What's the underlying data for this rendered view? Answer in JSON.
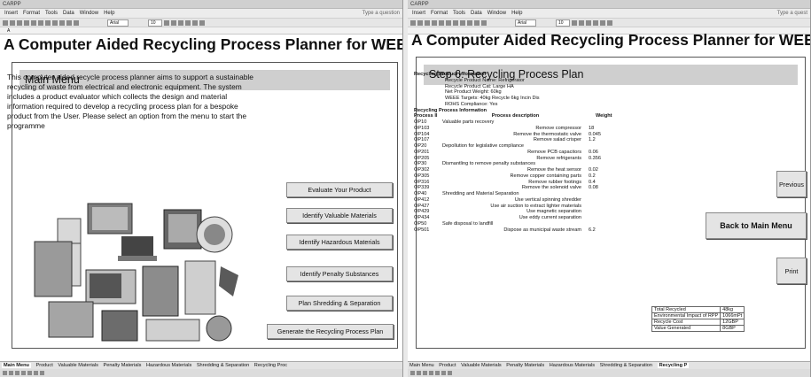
{
  "left": {
    "app_title": "CARPP",
    "menu": [
      "Insert",
      "Format",
      "Tools",
      "Data",
      "Window",
      "Help"
    ],
    "help_box": "Type a question",
    "font_name": "Arial",
    "font_size": "10",
    "name_box": "A",
    "page_title": "A Computer Aided Recycling Process Planner for WEEE",
    "panel_title": "Main Menu",
    "intro": "This computer aided recycle process planner aims to support a sustainable recycling of waste from electrical and electronic equipment. The system includes a product evaluator which collects the design and material information required to develop a recycling process plan for a bespoke product from the User. Please select an option from the menu to start the programme",
    "buttons": {
      "evaluate": "Evaluate Your Product",
      "valuable": "Identify Valuable Materials",
      "hazardous": "Identify Hazardous Materials",
      "penalty": "Identify Penalty Substances",
      "shredding": "Plan Shredding & Separation",
      "generate": "Generate the Recycling Process Plan"
    },
    "sheet_tabs": [
      "Main Menu",
      "Product",
      "Valuable Materials",
      "Penalty Materials",
      "Hazardous Materials",
      "Shredding & Separation",
      "Recycling Proc"
    ]
  },
  "right": {
    "app_title": "CARPP",
    "menu": [
      "Insert",
      "Format",
      "Tools",
      "Data",
      "Window",
      "Help"
    ],
    "help_box": "Type a quest",
    "font_name": "Arial",
    "font_size": "10",
    "page_title": "A Computer Aided Recycling Process Planner for WEEE",
    "panel_title": "Step 6: Recycling Process Plan",
    "product_info_heading": "Recycling Product Information",
    "product_info": [
      "Recycle Product Name: Refrigerator",
      "Recycle Product Cat: Large HA",
      "Net Product Weight: 60kg",
      "WEEE Targets: 40kg Recycle 6kg Incin Dis",
      "ROHS Compliance: Yes"
    ],
    "process_info_heading": "Recycling Process Information",
    "table_header": {
      "code": "Process II",
      "desc": "Process description",
      "weight": "Weight"
    },
    "rows": [
      {
        "code": "OP10",
        "desc": "Valuable parts recovery",
        "weight": "",
        "group": true
      },
      {
        "code": "OP103",
        "desc": "Remove compressor",
        "weight": "18",
        "group": false
      },
      {
        "code": "OP104",
        "desc": "Remove the thermostatic valve",
        "weight": "0.045",
        "group": false
      },
      {
        "code": "OP107",
        "desc": "Remove salad crisper",
        "weight": "1.2",
        "group": false
      },
      {
        "code": "OP20",
        "desc": "Depollution for legislative compliance",
        "weight": "",
        "group": true
      },
      {
        "code": "OP201",
        "desc": "Remove PCB capacitors",
        "weight": "0.06",
        "group": false
      },
      {
        "code": "OP205",
        "desc": "Remove refrigerants",
        "weight": "0.356",
        "group": false
      },
      {
        "code": "OP30",
        "desc": "Dismantling to remove penalty substances",
        "weight": "",
        "group": true
      },
      {
        "code": "OP302",
        "desc": "Remove the heat sensor",
        "weight": "0.02",
        "group": false
      },
      {
        "code": "OP305",
        "desc": "Remove copper containing parts",
        "weight": "0.2",
        "group": false
      },
      {
        "code": "OP316",
        "desc": "Remove rubber footings",
        "weight": "0.4",
        "group": false
      },
      {
        "code": "OP339",
        "desc": "Remove the solenoid valve",
        "weight": "0.08",
        "group": false
      },
      {
        "code": "OP40",
        "desc": "Shredding and Material Separation",
        "weight": "",
        "group": true
      },
      {
        "code": "OP412",
        "desc": "Use vertical spinning shredder",
        "weight": "",
        "group": false
      },
      {
        "code": "OP427",
        "desc": "Use air suction to extract lighter materials",
        "weight": "",
        "group": false
      },
      {
        "code": "OP429",
        "desc": "Use magnetic separation",
        "weight": "",
        "group": false
      },
      {
        "code": "OP434",
        "desc": "Use eddy current separation",
        "weight": "",
        "group": false
      },
      {
        "code": "OP50",
        "desc": "Safe disposal to landfill",
        "weight": "",
        "group": true
      },
      {
        "code": "OP501",
        "desc": "Dispose as municipal waste stream",
        "weight": "6.2",
        "group": false
      }
    ],
    "buttons": {
      "previous": "Previous",
      "back": "Back to Main Menu",
      "print": "Print"
    },
    "summary": [
      {
        "label": "Total Recycled",
        "value": "48kg"
      },
      {
        "label": "Environmental Impact of RPP",
        "value": "1066mPt"
      },
      {
        "label": "Recycle Cost",
        "value": "12GBP"
      },
      {
        "label": "Value Generated",
        "value": "8GBP"
      }
    ],
    "sheet_tabs": [
      "Main Menu",
      "Product",
      "Valuable Materials",
      "Penalty Materials",
      "Hazardous Materials",
      "Shredding & Separation",
      "Recycling P"
    ]
  }
}
